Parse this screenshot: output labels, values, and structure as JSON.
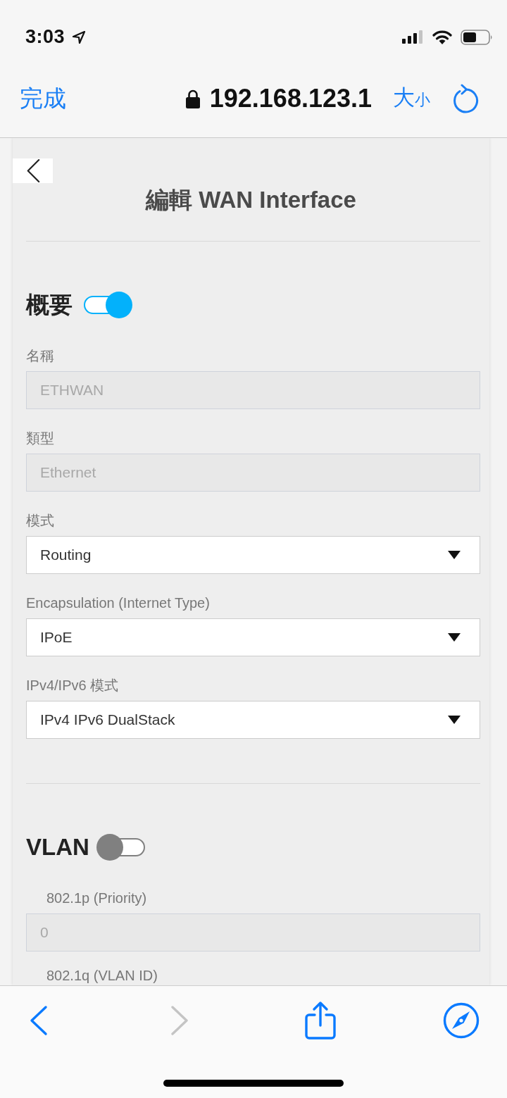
{
  "status_bar": {
    "time": "3:03"
  },
  "address_bar": {
    "done": "完成",
    "url": "192.168.123.1",
    "text_size": "大小"
  },
  "page": {
    "title": "編輯 WAN Interface",
    "sections": [
      {
        "title": "概要",
        "enabled": true,
        "fields": [
          {
            "kind": "text",
            "label": "名稱",
            "value": "ETHWAN",
            "disabled": true
          },
          {
            "kind": "text",
            "label": "類型",
            "value": "Ethernet",
            "disabled": true
          },
          {
            "kind": "select",
            "label": "模式",
            "value": "Routing",
            "disabled": false
          },
          {
            "kind": "select",
            "label": "Encapsulation (Internet Type)",
            "value": "IPoE",
            "disabled": false
          },
          {
            "kind": "select",
            "label": "IPv4/IPv6 模式",
            "value": "IPv4 IPv6 DualStack",
            "disabled": false
          }
        ]
      },
      {
        "title": "VLAN",
        "enabled": false,
        "fields": [
          {
            "kind": "text",
            "label": "802.1p (Priority)",
            "value": "0",
            "disabled": true
          },
          {
            "kind": "label",
            "label": "802.1q (VLAN ID)"
          }
        ]
      }
    ]
  },
  "toolbar": {
    "navigation": [
      {
        "kind": "back",
        "disabled": false
      },
      {
        "kind": "forward",
        "disabled": true
      }
    ]
  }
}
